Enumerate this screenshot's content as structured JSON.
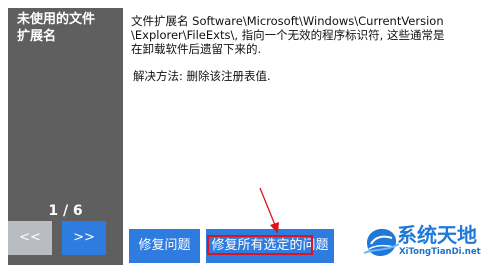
{
  "issue": {
    "title": "未使用的文件\n扩展名",
    "description": "文件扩展名 Software\\Microsoft\\Windows\\CurrentVersion\n\\Explorer\\FileExts\\, 指向一个无效的程序标识符, 这些通常是\n在卸载软件后遗留下来的.",
    "solution": "解决方法: 删除该注册表值."
  },
  "pager": {
    "counter": "1 / 6",
    "prev_label": "<<",
    "next_label": ">>"
  },
  "actions": {
    "fix_label": "修复问题",
    "fix_all_label": "修复所有选定的问题"
  },
  "watermark": {
    "title": "系统天地",
    "url": "XiTongTianDi.net"
  },
  "colors": {
    "panel": "#5f5f5f",
    "accent": "#2f7ce1",
    "disabled": "#b9bcc3",
    "annotation": "#e0131b",
    "watermark": "#1f79d8"
  }
}
